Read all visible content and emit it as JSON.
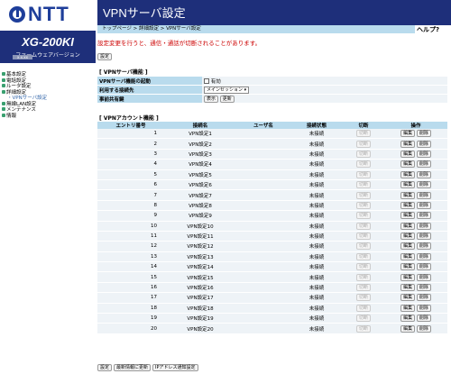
{
  "brand": {
    "logo_text": "NTT",
    "model": "XG-200KI",
    "fw_label": "ファームウェアバージョン",
    "fw_version": "x.x.xx"
  },
  "nav": {
    "items": [
      "基本設定",
      "電話設定",
      "ルータ設定",
      "詳細設定"
    ],
    "sub": "・VPNサーバ設定",
    "items2": [
      "無線LAN設定",
      "メンテナンス",
      "情報"
    ]
  },
  "header": {
    "title": "VPNサーバ設定",
    "breadcrumb": "トップページ > 詳細設定 > VPNサーバ設定",
    "help": "ヘルプ?"
  },
  "warning": "設定変更を行うと、通信・通話が切断されることがあります。",
  "buttons": {
    "set_top": "設定",
    "display": "表示",
    "update": "更新",
    "set": "設定",
    "refresh": "最新情報に更新",
    "ip_notify": "IPアドレス通知設定",
    "disconnect": "切断",
    "edit": "編集",
    "delete": "削除"
  },
  "server": {
    "section_title": "[ VPNサーバ機能 ]",
    "rows": [
      {
        "label": "VPNサーバ機能の起動",
        "value": "有効"
      },
      {
        "label": "利用する接続先",
        "value": "メインセッション"
      },
      {
        "label": "事前共有鍵",
        "value": ""
      }
    ]
  },
  "accounts": {
    "section_title": "[ VPNアカウント機能 ]",
    "headers": [
      "エントリ番号",
      "接続名",
      "ユーザ名",
      "接続状態",
      "切断",
      "操作"
    ],
    "rows": [
      {
        "no": "1",
        "name": "VPN設定1",
        "user": "",
        "status": "未接続"
      },
      {
        "no": "2",
        "name": "VPN設定2",
        "user": "",
        "status": "未接続"
      },
      {
        "no": "3",
        "name": "VPN設定3",
        "user": "",
        "status": "未接続"
      },
      {
        "no": "4",
        "name": "VPN設定4",
        "user": "",
        "status": "未接続"
      },
      {
        "no": "5",
        "name": "VPN設定5",
        "user": "",
        "status": "未接続"
      },
      {
        "no": "6",
        "name": "VPN設定6",
        "user": "",
        "status": "未接続"
      },
      {
        "no": "7",
        "name": "VPN設定7",
        "user": "",
        "status": "未接続"
      },
      {
        "no": "8",
        "name": "VPN設定8",
        "user": "",
        "status": "未接続"
      },
      {
        "no": "9",
        "name": "VPN設定9",
        "user": "",
        "status": "未接続"
      },
      {
        "no": "10",
        "name": "VPN設定10",
        "user": "",
        "status": "未接続"
      },
      {
        "no": "11",
        "name": "VPN設定11",
        "user": "",
        "status": "未接続"
      },
      {
        "no": "12",
        "name": "VPN設定12",
        "user": "",
        "status": "未接続"
      },
      {
        "no": "13",
        "name": "VPN設定13",
        "user": "",
        "status": "未接続"
      },
      {
        "no": "14",
        "name": "VPN設定14",
        "user": "",
        "status": "未接続"
      },
      {
        "no": "15",
        "name": "VPN設定15",
        "user": "",
        "status": "未接続"
      },
      {
        "no": "16",
        "name": "VPN設定16",
        "user": "",
        "status": "未接続"
      },
      {
        "no": "17",
        "name": "VPN設定17",
        "user": "",
        "status": "未接続"
      },
      {
        "no": "18",
        "name": "VPN設定18",
        "user": "",
        "status": "未接続"
      },
      {
        "no": "19",
        "name": "VPN設定19",
        "user": "",
        "status": "未接続"
      },
      {
        "no": "20",
        "name": "VPN設定20",
        "user": "",
        "status": "未接続"
      }
    ]
  },
  "colors": {
    "brand_navy": "#1e2f7a",
    "logo_blue": "#1e3e9a",
    "label_bg": "#b9dbed",
    "warn_red": "#cc0000"
  }
}
